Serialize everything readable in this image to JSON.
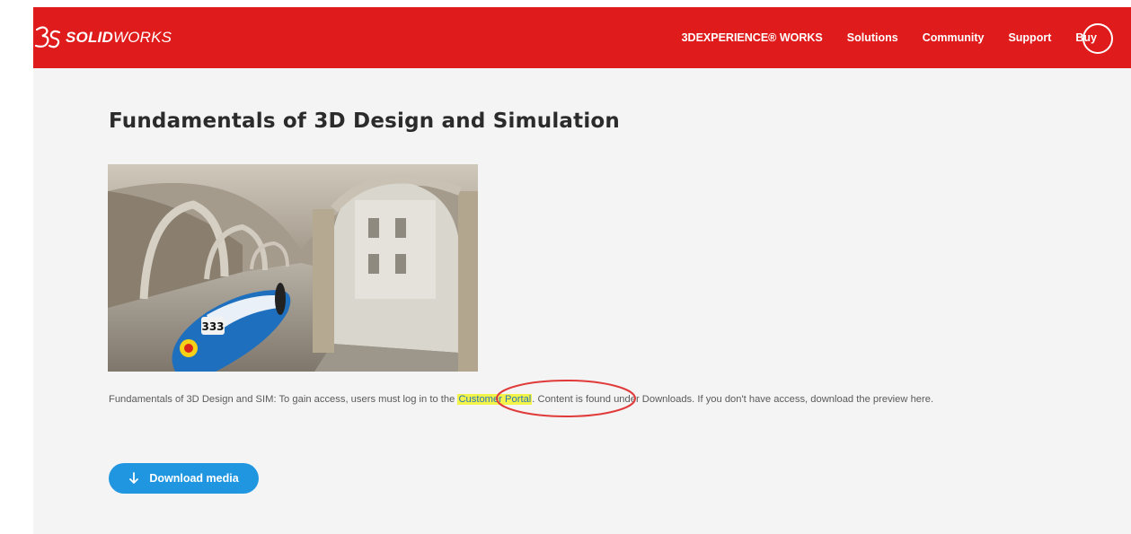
{
  "brand": {
    "logo_bold": "SOLID",
    "logo_light": "WORKS"
  },
  "nav": {
    "items": [
      "3DEXPERIENCE® WORKS",
      "Solutions",
      "Community",
      "Support",
      "Buy"
    ]
  },
  "page": {
    "title": "Fundamentals of 3D Design and Simulation",
    "description_prefix": "Fundamentals of 3D Design and SIM: To gain access, users must log in to the",
    "portal_link": "Customer Portal",
    "description_suffix": ". Content is found under Downloads. If you don't have access, download the preview here.",
    "hero_image": {
      "car_number": "333"
    },
    "download_button": "Download media"
  },
  "icons": {
    "logo": "3ds-logo-icon",
    "download": "arrow-down-icon",
    "nav_circle": "circle-icon"
  },
  "colors": {
    "header": "#e01b1b",
    "background": "#f4f4f4",
    "button": "#2196e0",
    "highlight": "#f3f34a",
    "annotation": "#e03a3a",
    "link": "#2a76b8"
  }
}
